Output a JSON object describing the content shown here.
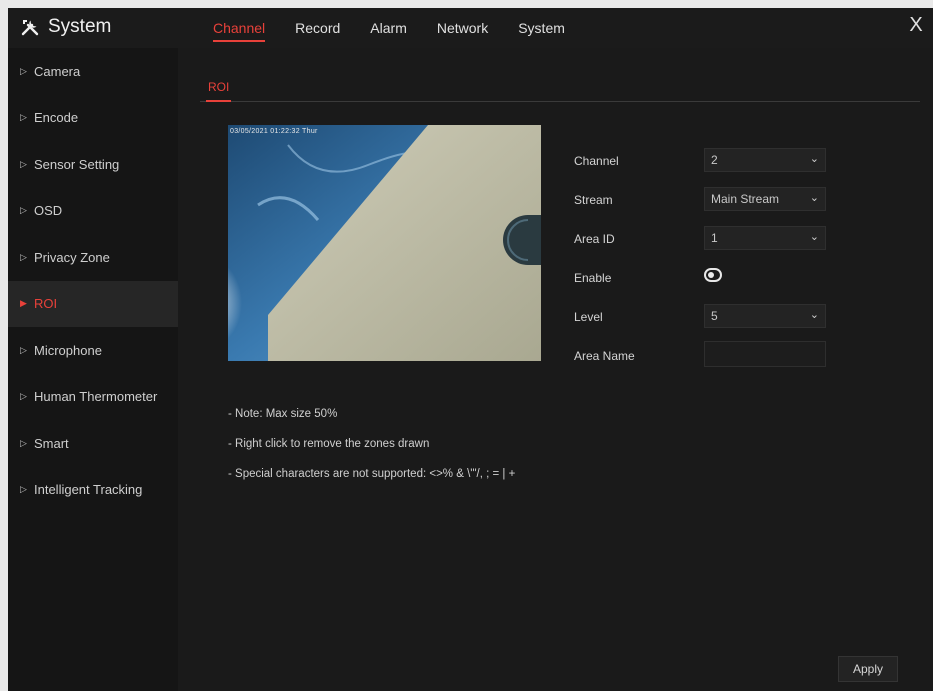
{
  "app": {
    "title": "System"
  },
  "top_tabs": [
    {
      "label": "Channel",
      "active": true
    },
    {
      "label": "Record",
      "active": false
    },
    {
      "label": "Alarm",
      "active": false
    },
    {
      "label": "Network",
      "active": false
    },
    {
      "label": "System",
      "active": false
    }
  ],
  "sidebar": {
    "items": [
      {
        "label": "Camera"
      },
      {
        "label": "Encode"
      },
      {
        "label": "Sensor Setting"
      },
      {
        "label": "OSD"
      },
      {
        "label": "Privacy Zone"
      },
      {
        "label": "ROI",
        "active": true
      },
      {
        "label": "Microphone"
      },
      {
        "label": "Human Thermometer"
      },
      {
        "label": "Smart"
      },
      {
        "label": "Intelligent Tracking"
      }
    ]
  },
  "sub_tab": {
    "label": "ROI"
  },
  "preview": {
    "timestamp": "03/05/2021 01:22:32 Thur"
  },
  "form": {
    "channel": {
      "label": "Channel",
      "value": "2"
    },
    "stream": {
      "label": "Stream",
      "value": "Main Stream"
    },
    "area_id": {
      "label": "Area ID",
      "value": "1"
    },
    "enable": {
      "label": "Enable",
      "value": true
    },
    "level": {
      "label": "Level",
      "value": "5"
    },
    "area_name": {
      "label": "Area Name",
      "value": ""
    }
  },
  "notes": [
    "- Note: Max size 50%",
    "- Right click to remove the zones drawn",
    "- Special characters are not supported: <>% & \\'\"/, ; = | +"
  ],
  "apply_label": "Apply",
  "close_glyph": "X",
  "colors": {
    "accent": "#e8413a",
    "background": "#1a1a1a",
    "sidebar": "#151515"
  }
}
